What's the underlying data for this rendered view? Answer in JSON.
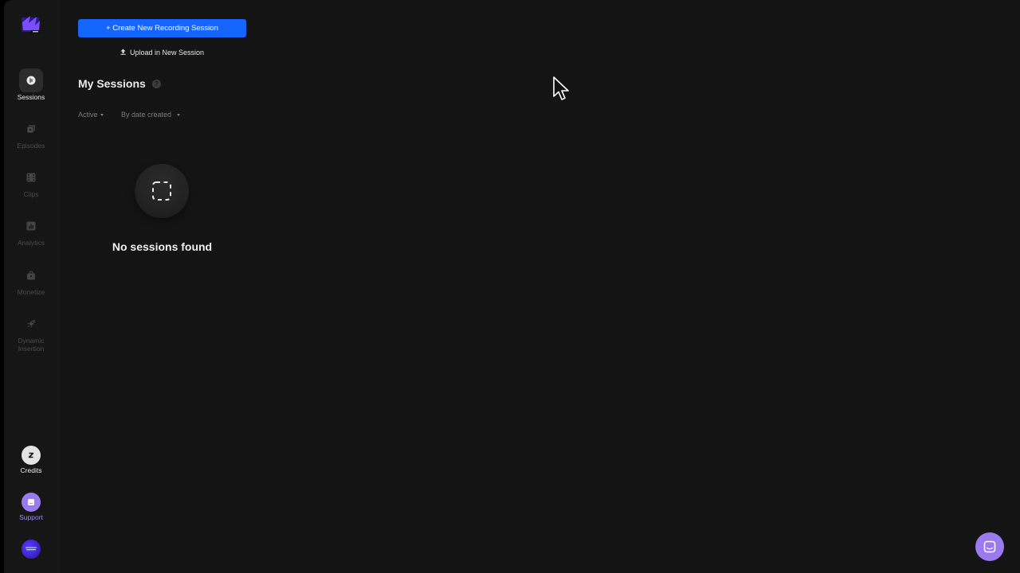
{
  "sidebar": {
    "items": [
      {
        "label": "Sessions",
        "icon": "mic-icon",
        "active": true
      },
      {
        "label": "Episodes",
        "icon": "episodes-icon",
        "active": false
      },
      {
        "label": "Clips",
        "icon": "film-icon",
        "active": false
      },
      {
        "label": "Analytics",
        "icon": "chart-icon",
        "active": false
      },
      {
        "label": "Monetize",
        "icon": "bag-icon",
        "active": false
      },
      {
        "label": "Dynamic Insertion",
        "icon": "rocket-icon",
        "active": false
      }
    ],
    "credits_label": "Credits",
    "support_label": "Support"
  },
  "main": {
    "create_button_label": "+ Create New Recording Session",
    "upload_button_label": "Upload in New Session",
    "page_title": "My Sessions",
    "help_glyph": "?",
    "filters": {
      "status": "Active",
      "sort": "By date created"
    },
    "empty_state": {
      "message": "No sessions found"
    }
  },
  "colors": {
    "accent": "#1565ff",
    "support": "#9b8cff",
    "chat": "#9b7af0",
    "background": "#141414",
    "sidebar": "#161616"
  }
}
